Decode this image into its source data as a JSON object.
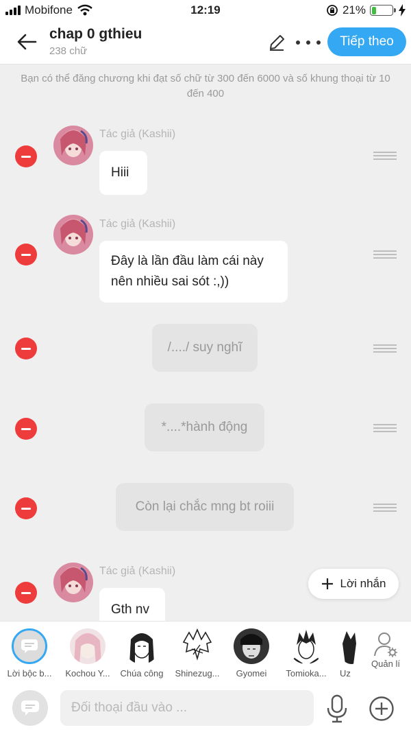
{
  "status_bar": {
    "carrier": "Mobifone",
    "time": "12:19",
    "battery": "21%",
    "battery_level": 0.21
  },
  "header": {
    "title": "chap 0 gthieu",
    "word_count": "238 chữ",
    "next_label": "Tiếp theo"
  },
  "info_text": "Bạn có thể đăng chương khi đạt số chữ từ 300 đến 6000 và số khung thoại từ 10 đến 400",
  "messages": [
    {
      "type": "dialog",
      "author": "Tác giả (Kashii)",
      "lines": [
        "Hiii"
      ]
    },
    {
      "type": "dialog",
      "author": "Tác giả (Kashii)",
      "lines": [
        "Đây là lần đầu làm cái này",
        "nên nhiều sai sót :,))"
      ]
    },
    {
      "type": "narration",
      "text": "/..../ suy nghĩ"
    },
    {
      "type": "narration",
      "text": "*....*hành động"
    },
    {
      "type": "narration",
      "text": "Còn lại chắc mng bt roiii"
    },
    {
      "type": "dialog",
      "author": "Tác giả (Kashii)",
      "lines": [
        "Gth nv"
      ]
    }
  ],
  "floating_button": {
    "label": "Lời nhắn"
  },
  "characters": [
    {
      "label": "Lời bộc b...",
      "icon": "narration-icon"
    },
    {
      "label": "Kochou Y...",
      "icon": "avatar"
    },
    {
      "label": "Chúa công",
      "icon": "avatar"
    },
    {
      "label": "Shinezug...",
      "icon": "avatar"
    },
    {
      "label": "Gyomei",
      "icon": "avatar"
    },
    {
      "label": "Tomioka...",
      "icon": "avatar"
    },
    {
      "label": "Uz",
      "icon": "avatar"
    },
    {
      "label": "Quản lí",
      "icon": "manage-user-icon"
    }
  ],
  "input": {
    "placeholder": "Đối thoại đầu vào ..."
  },
  "colors": {
    "accent": "#35a8f4",
    "remove": "#ee3b3b",
    "background": "#efefef"
  }
}
